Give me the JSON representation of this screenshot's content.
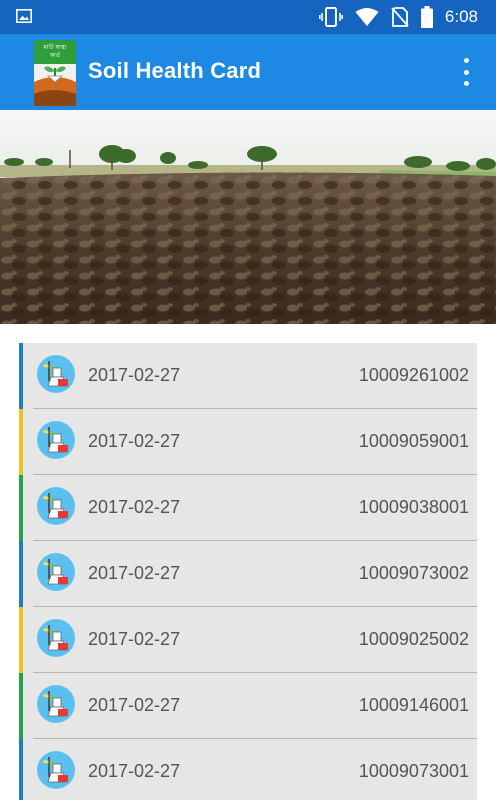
{
  "status_bar": {
    "time": "6:08"
  },
  "app_bar": {
    "title": "Soil Health Card",
    "logo_text_line1": "মাটি স্বাস্থ্য",
    "logo_text_line2": "কার্ড"
  },
  "cards": [
    {
      "date": "2017-02-27",
      "number": "10009261002",
      "accent": "#1e7fc0"
    },
    {
      "date": "2017-02-27",
      "number": "10009059001",
      "accent": "#f2c21b"
    },
    {
      "date": "2017-02-27",
      "number": "10009038001",
      "accent": "#1fa64a"
    },
    {
      "date": "2017-02-27",
      "number": "10009073002",
      "accent": "#1e7fc0"
    },
    {
      "date": "2017-02-27",
      "number": "10009025002",
      "accent": "#f2c21b"
    },
    {
      "date": "2017-02-27",
      "number": "10009146001",
      "accent": "#1fa64a"
    },
    {
      "date": "2017-02-27",
      "number": "10009073001",
      "accent": "#1e7fc0"
    }
  ],
  "colors": {
    "status_bar": "#1565c0",
    "app_bar": "#1e88e5",
    "row_bg": "#e6e6e6"
  }
}
